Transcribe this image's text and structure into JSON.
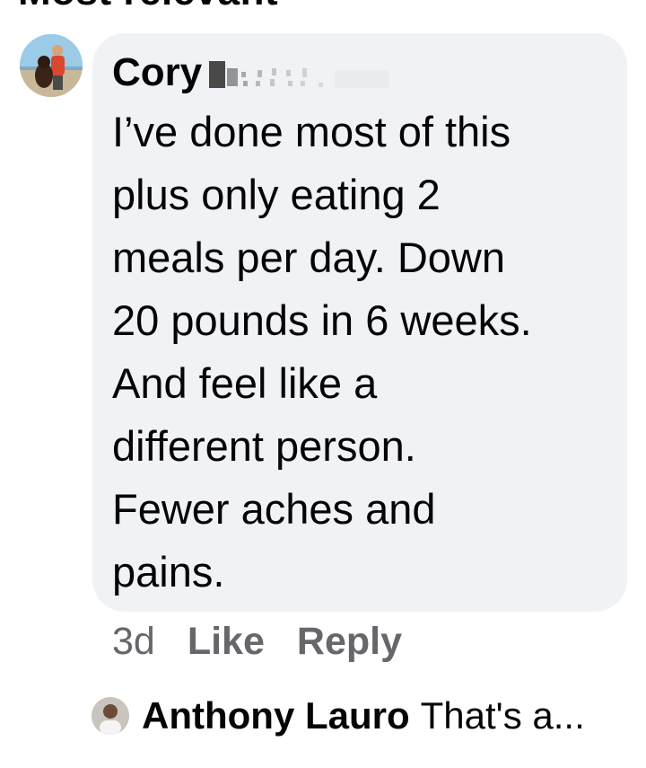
{
  "section_header": "Most relevant",
  "comment": {
    "author": "Cory",
    "text": "I’ve done most of this\nplus only eating 2\nmeals per day.  Down\n20 pounds in 6 weeks.\nAnd feel like a\ndifferent person.\nFewer aches and\npains.",
    "time": "3d",
    "like_label": "Like",
    "reply_label": "Reply"
  },
  "reply": {
    "author": "Anthony Lauro",
    "snippet": "That's a..."
  }
}
